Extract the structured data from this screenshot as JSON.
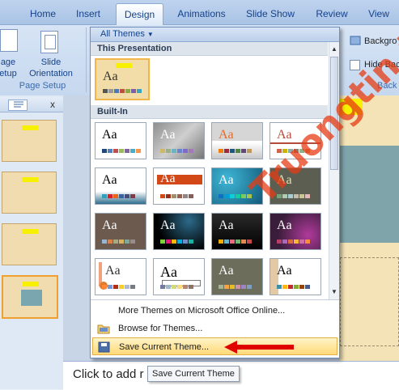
{
  "tabs": [
    {
      "label": "Home",
      "active": false
    },
    {
      "label": "Insert",
      "active": false
    },
    {
      "label": "Design",
      "active": true
    },
    {
      "label": "Animations",
      "active": false
    },
    {
      "label": "Slide Show",
      "active": false
    },
    {
      "label": "Review",
      "active": false
    },
    {
      "label": "View",
      "active": false
    }
  ],
  "ribbon": {
    "page_setup_label": "age\netup",
    "slide_orientation_label": "Slide\nOrientation",
    "page_setup_group": "Page Setup",
    "background_label": "Backgro",
    "hide_background_label": "Hide Bac",
    "back_group": "Back"
  },
  "gallery": {
    "header_button": "All Themes",
    "section_this_presentation": "This Presentation",
    "section_built_in": "Built-In",
    "theme_sample": "Aa"
  },
  "menu": {
    "more_themes": "More Themes on Microsoft Office Online...",
    "browse_themes": "Browse for Themes...",
    "save_theme": "Save Current Theme..."
  },
  "notes_text": "Click to add r",
  "tooltip": "Save Current Theme",
  "slides_pane": {
    "close": "x"
  },
  "colors": {
    "accent_arrow": "#e00000",
    "active_menu": "#ffe69a",
    "tab_text": "#15428b"
  },
  "watermark": "Truongtin.top"
}
